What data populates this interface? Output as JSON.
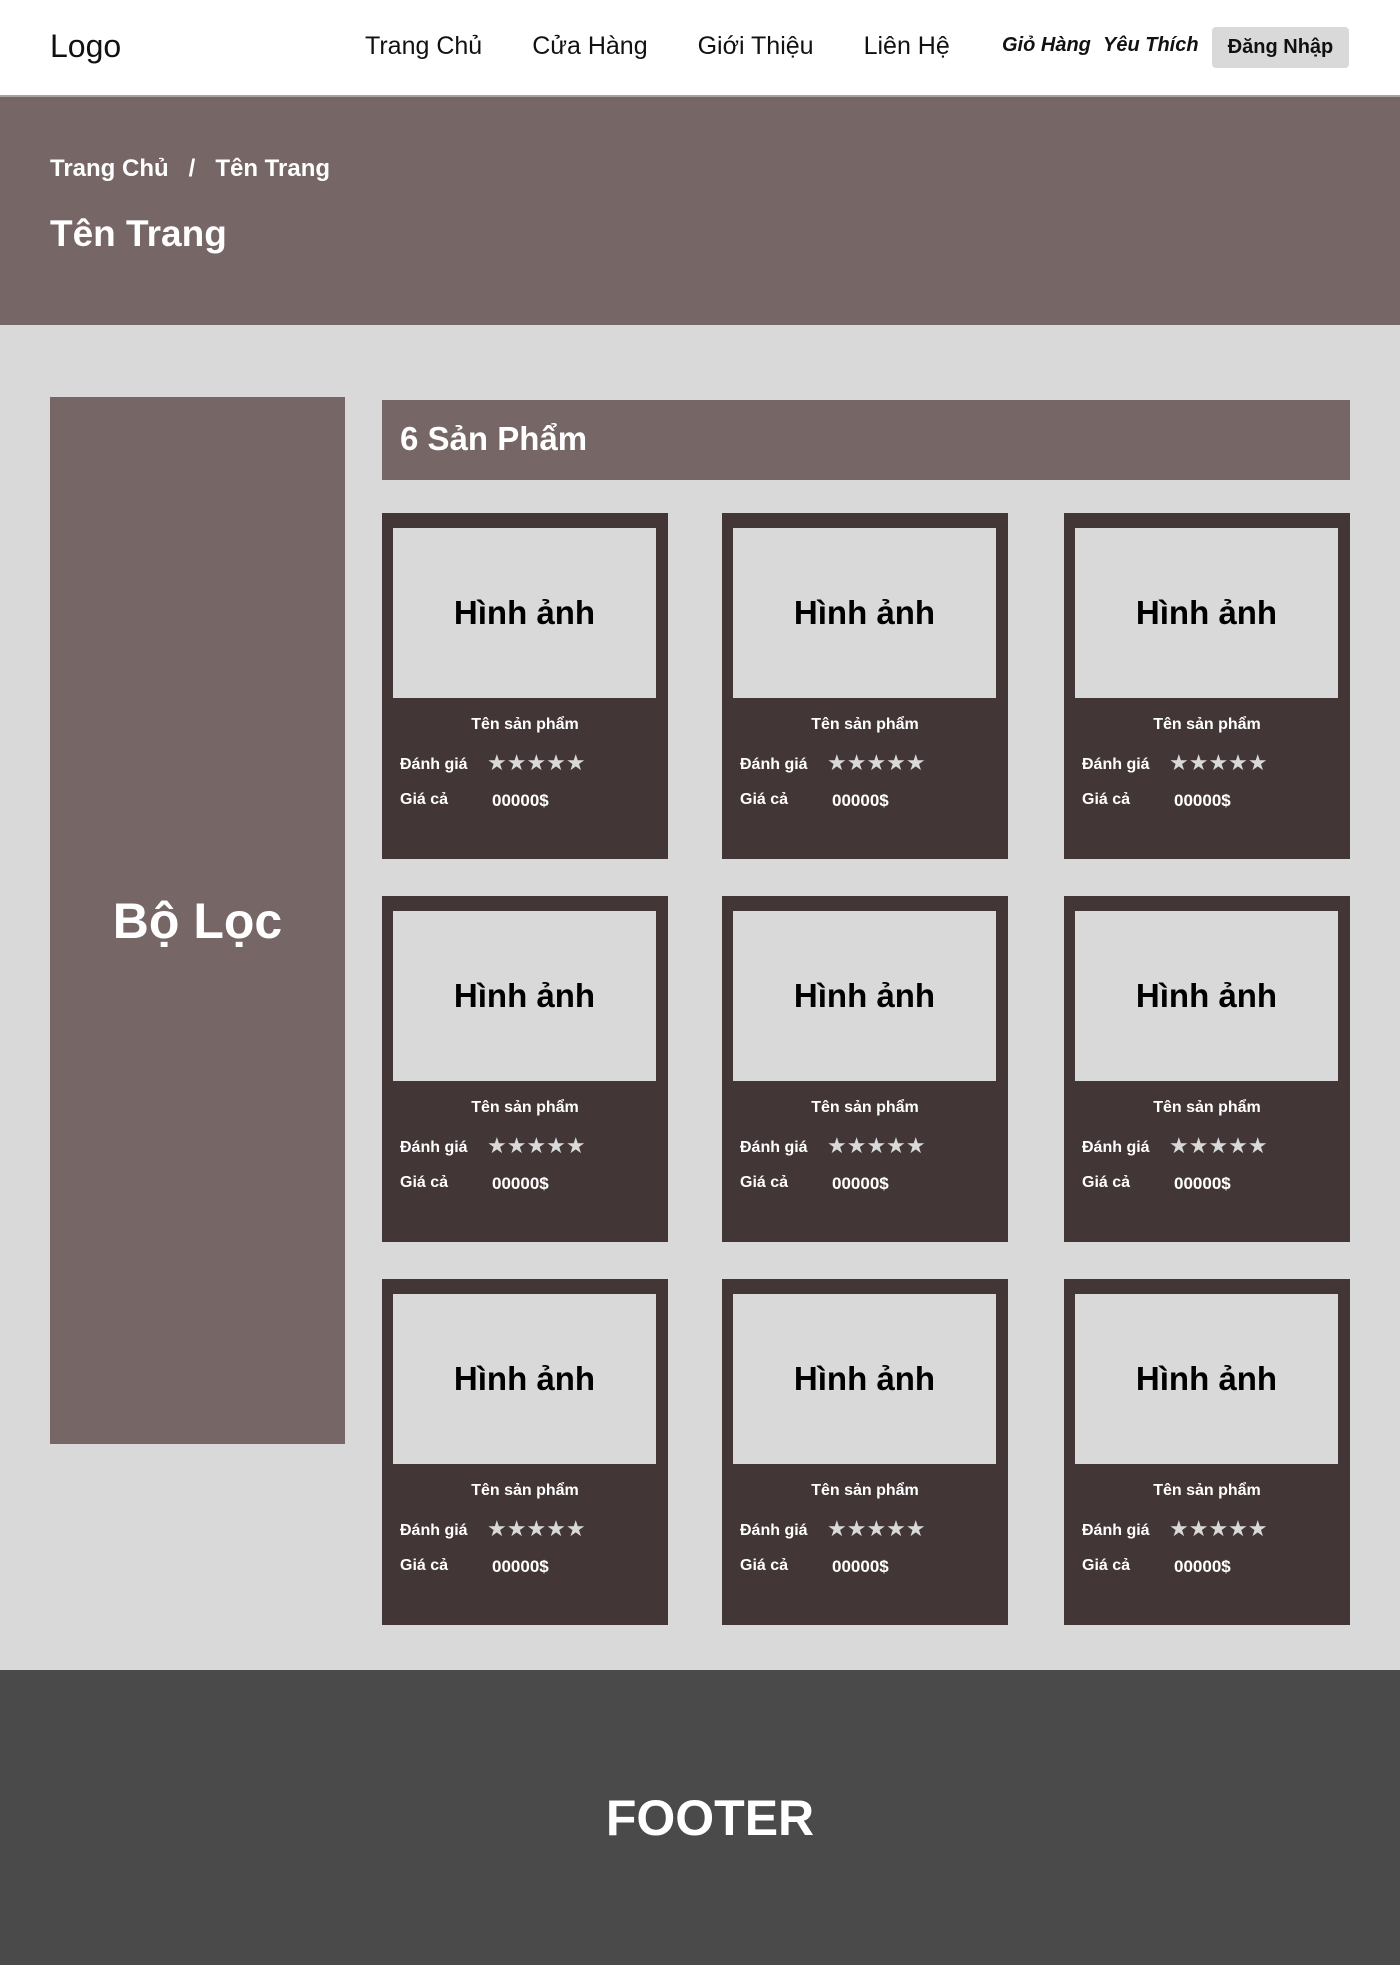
{
  "header": {
    "logo": "Logo",
    "nav": [
      "Trang Chủ",
      "Cửa Hàng",
      "Giới Thiệu",
      "Liên Hệ"
    ],
    "cart": "Giỏ Hàng",
    "favorites": "Yêu Thích",
    "login": "Đăng Nhập"
  },
  "banner": {
    "breadcrumb": {
      "home": "Trang Chủ",
      "separator": "/",
      "current": "Tên Trang"
    },
    "title": "Tên Trang"
  },
  "filter": {
    "label": "Bộ Lọc"
  },
  "products": {
    "count_label": "6 Sản Phẩm",
    "items": [
      {
        "image_label": "Hình ảnh",
        "name": "Tên sản phẩm",
        "rating_label": "Đánh giá",
        "stars": "★★★★★",
        "price_label": "Giá cả",
        "price": "00000$"
      },
      {
        "image_label": "Hình ảnh",
        "name": "Tên sản phẩm",
        "rating_label": "Đánh giá",
        "stars": "★★★★★",
        "price_label": "Giá cả",
        "price": "00000$"
      },
      {
        "image_label": "Hình ảnh",
        "name": "Tên sản phẩm",
        "rating_label": "Đánh giá",
        "stars": "★★★★★",
        "price_label": "Giá cả",
        "price": "00000$"
      },
      {
        "image_label": "Hình ảnh",
        "name": "Tên sản phẩm",
        "rating_label": "Đánh giá",
        "stars": "★★★★★",
        "price_label": "Giá cả",
        "price": "00000$"
      },
      {
        "image_label": "Hình ảnh",
        "name": "Tên sản phẩm",
        "rating_label": "Đánh giá",
        "stars": "★★★★★",
        "price_label": "Giá cả",
        "price": "00000$"
      },
      {
        "image_label": "Hình ảnh",
        "name": "Tên sản phẩm",
        "rating_label": "Đánh giá",
        "stars": "★★★★★",
        "price_label": "Giá cả",
        "price": "00000$"
      },
      {
        "image_label": "Hình ảnh",
        "name": "Tên sản phẩm",
        "rating_label": "Đánh giá",
        "stars": "★★★★★",
        "price_label": "Giá cả",
        "price": "00000$"
      },
      {
        "image_label": "Hình ảnh",
        "name": "Tên sản phẩm",
        "rating_label": "Đánh giá",
        "stars": "★★★★★",
        "price_label": "Giá cả",
        "price": "00000$"
      },
      {
        "image_label": "Hình ảnh",
        "name": "Tên sản phẩm",
        "rating_label": "Đánh giá",
        "stars": "★★★★★",
        "price_label": "Giá cả",
        "price": "00000$"
      }
    ]
  },
  "footer": {
    "label": "FOOTER"
  },
  "colors": {
    "header_bg": "#ffffff",
    "banner_bg": "#766666",
    "page_bg": "#d9d9d9",
    "card_bg": "#433636",
    "footer_bg": "#4a4a4a"
  }
}
